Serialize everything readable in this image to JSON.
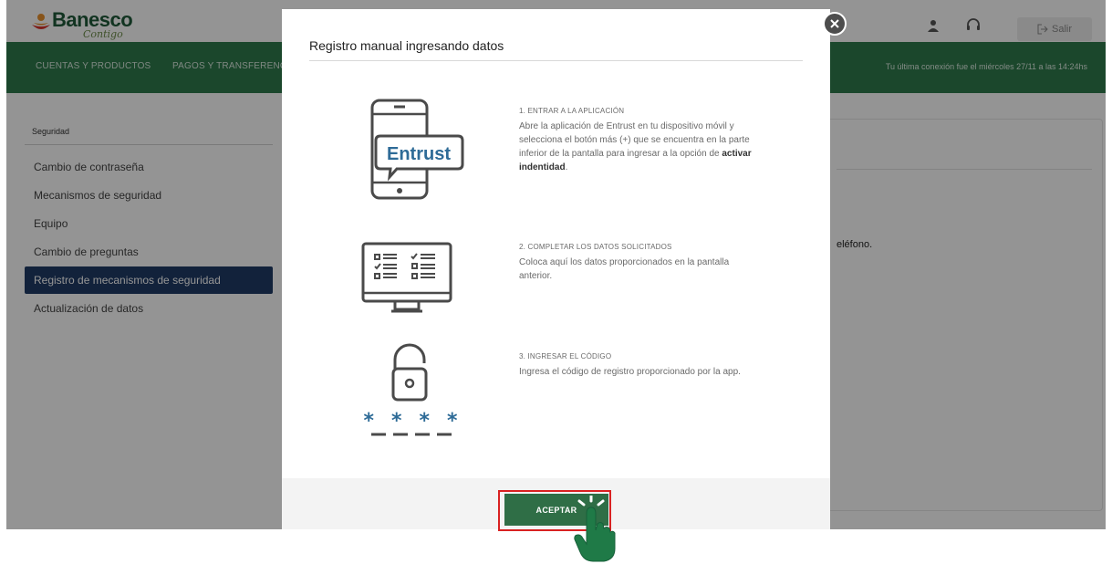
{
  "header": {
    "brand": "Banesco",
    "tagline": "Contigo",
    "user_name": "",
    "logout_label": "Salir"
  },
  "nav": {
    "items": [
      "CUENTAS Y PRODUCTOS",
      "PAGOS Y TRANSFERENCIA"
    ],
    "last_connection": "Tu última conexión fue el miércoles 27/11 a las 14:24hs"
  },
  "sidebar": {
    "title": "Seguridad",
    "items": [
      {
        "label": "Cambio de contraseña",
        "active": false
      },
      {
        "label": "Mecanismos de seguridad",
        "active": false
      },
      {
        "label": "Equipo",
        "active": false
      },
      {
        "label": "Cambio de preguntas",
        "active": false
      },
      {
        "label": "Registro de mecanismos de seguridad",
        "active": true
      },
      {
        "label": "Actualización de datos",
        "active": false
      }
    ]
  },
  "content": {
    "partial_text": "eléfono."
  },
  "modal": {
    "title": "Registro manual ingresando datos",
    "steps": [
      {
        "heading": "1. ENTRAR A LA APLICACIÓN",
        "body_before": "Abre la aplicación de Entrust en tu dispositivo móvil y selecciona el botón más (+) que se encuentra en la parte inferior de la pantalla para ingresar a la opción de ",
        "body_bold": "activar indentidad",
        "body_after": ".",
        "icon": "phone-entrust-icon",
        "icon_text": "Entrust"
      },
      {
        "heading": "2. COMPLETAR LOS DATOS SOLICITADOS",
        "body_before": "Coloca aquí los datos proporcionados en la pantalla anterior.",
        "body_bold": "",
        "body_after": "",
        "icon": "monitor-form-icon"
      },
      {
        "heading": "3. INGRESAR EL CÓDIGO",
        "body_before": "Ingresa el código de registro proporcionado por la app.",
        "body_bold": "",
        "body_after": "",
        "icon": "padlock-code-icon",
        "icon_text": "* * * *"
      }
    ],
    "accept_label": "ACEPTAR"
  },
  "colors": {
    "brand_green": "#2f7a4c",
    "button_green": "#2f6e46",
    "active_blue": "#1f3b66",
    "highlight_red": "#d92121"
  }
}
